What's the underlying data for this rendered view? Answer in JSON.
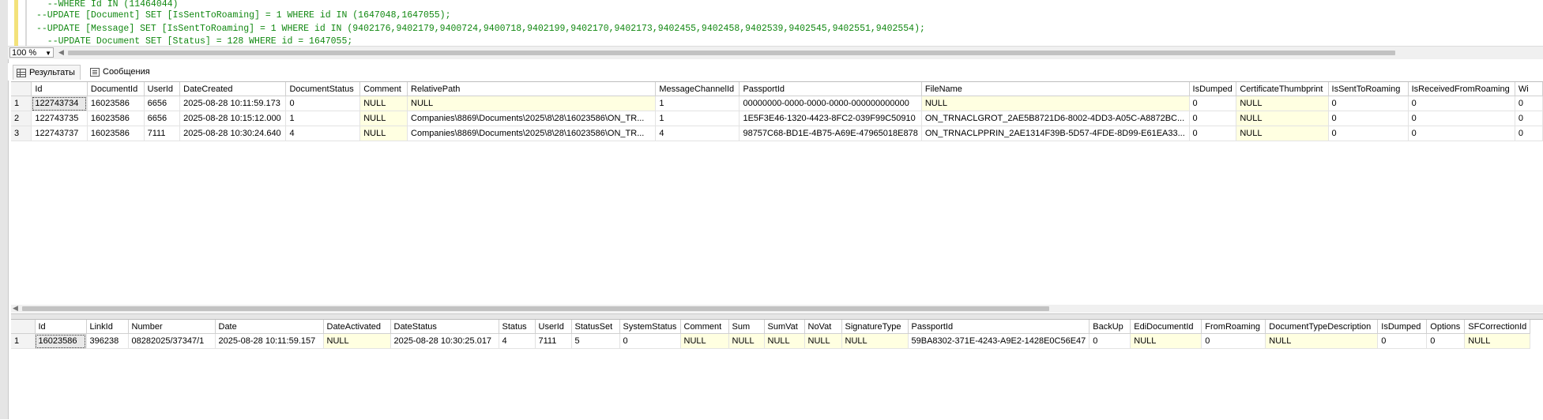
{
  "editor": {
    "lines": [
      "  --WHERE Id IN (11464044)",
      "--UPDATE [Document] SET [IsSentToRoaming] = 1 WHERE id IN (1647048,1647055);",
      "--UPDATE [Message] SET [IsSentToRoaming] = 1 WHERE id IN (9402176,9402179,9400724,9400718,9402199,9402170,9402173,9402455,9402458,9402539,9402545,9402551,9402554);",
      "  --UPDATE Document SET [Status] = 128 WHERE id = 1647055;"
    ]
  },
  "zoom": {
    "value": "100 %"
  },
  "tabs": [
    {
      "label": "Результаты",
      "icon": "grid-icon"
    },
    {
      "label": "Сообщения",
      "icon": "messages-icon"
    }
  ],
  "grid1": {
    "columns": [
      "Id",
      "DocumentId",
      "UserId",
      "DateCreated",
      "DocumentStatus",
      "Comment",
      "RelativePath",
      "MessageChannelId",
      "PassportId",
      "FileName",
      "IsDumped",
      "CertificateThumbprint",
      "IsSentToRoaming",
      "IsReceivedFromRoaming",
      "Wi"
    ],
    "rows": [
      {
        "n": "1",
        "cells": [
          "122743734",
          "16023586",
          "6656",
          "2025-08-28 10:11:59.173",
          "0",
          "NULL",
          "NULL",
          "1",
          "00000000-0000-0000-0000-000000000000",
          "NULL",
          "0",
          "NULL",
          "0",
          "0",
          "0"
        ]
      },
      {
        "n": "2",
        "cells": [
          "122743735",
          "16023586",
          "6656",
          "2025-08-28 10:15:12.000",
          "1",
          "NULL",
          "Companies\\8869\\Documents\\2025\\8\\28\\16023586\\ON_TR...",
          "1",
          "1E5F3E46-1320-4423-8FC2-039F99C50910",
          "ON_TRNACLGROT_2AE5B8721D6-8002-4DD3-A05C-A8872BC...",
          "0",
          "NULL",
          "0",
          "0",
          "0"
        ]
      },
      {
        "n": "3",
        "cells": [
          "122743737",
          "16023586",
          "7111",
          "2025-08-28 10:30:24.640",
          "4",
          "NULL",
          "Companies\\8869\\Documents\\2025\\8\\28\\16023586\\ON_TR...",
          "4",
          "98757C68-BD1E-4B75-A69E-47965018E878",
          "ON_TRNACLPPRIN_2AE1314F39B-5D57-4FDE-8D99-E61EA33...",
          "0",
          "NULL",
          "0",
          "0",
          "0"
        ]
      }
    ]
  },
  "grid2": {
    "columns": [
      "Id",
      "LinkId",
      "Number",
      "Date",
      "DateActivated",
      "DateStatus",
      "Status",
      "UserId",
      "StatusSet",
      "SystemStatus",
      "Comment",
      "Sum",
      "SumVat",
      "NoVat",
      "SignatureType",
      "PassportId",
      "BackUp",
      "EdiDocumentId",
      "FromRoaming",
      "DocumentTypeDescription",
      "IsDumped",
      "Options",
      "SFCorrectionId"
    ],
    "rows": [
      {
        "n": "1",
        "cells": [
          "16023586",
          "396238",
          "08282025/37347/1",
          "2025-08-28 10:11:59.157",
          "NULL",
          "2025-08-28 10:30:25.017",
          "4",
          "7111",
          "5",
          "0",
          "NULL",
          "NULL",
          "NULL",
          "NULL",
          "NULL",
          "59BA8302-371E-4243-A9E2-1428E0C56E47",
          "0",
          "NULL",
          "0",
          "NULL",
          "0",
          "0",
          "NULL"
        ]
      }
    ]
  },
  "colors": {
    "comment_green": "#118811",
    "null_bg": "#ffffe1",
    "margin_yellow": "#f3e27a"
  }
}
